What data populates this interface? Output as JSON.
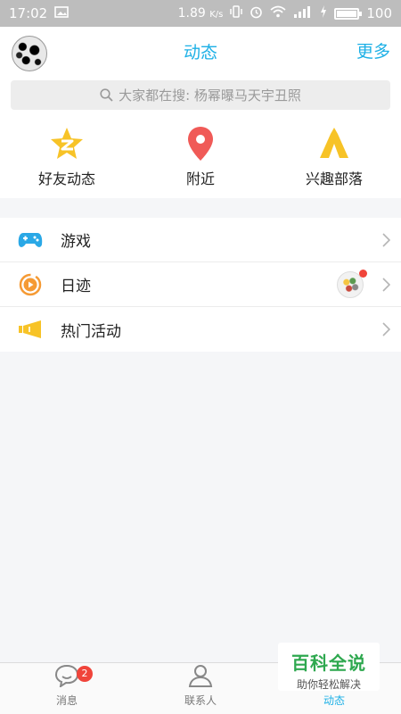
{
  "status_bar": {
    "time": "17:02",
    "speed": "1.89",
    "speed_unit": "K/s",
    "battery": "100"
  },
  "header": {
    "title": "动态",
    "more_label": "更多"
  },
  "search": {
    "placeholder": "大家都在搜: 杨幂曝马天宇丑照"
  },
  "shortcuts": [
    {
      "label": "好友动态",
      "icon": "qzone-star-icon",
      "color": "#f7c327"
    },
    {
      "label": "附近",
      "icon": "location-pin-icon",
      "color": "#f05a57"
    },
    {
      "label": "兴趣部落",
      "icon": "tent-icon",
      "color": "#f7c327"
    }
  ],
  "list": [
    {
      "label": "游戏",
      "icon": "gamepad-icon",
      "color": "#2aa8e6"
    },
    {
      "label": "日迹",
      "icon": "play-circle-icon",
      "color": "#f59a34"
    },
    {
      "label": "热门活动",
      "icon": "megaphone-icon",
      "color": "#f7c327"
    }
  ],
  "tabs": [
    {
      "label": "消息",
      "icon": "chat-bubble-icon",
      "badge": "2"
    },
    {
      "label": "联系人",
      "icon": "contacts-icon"
    },
    {
      "label": "动态",
      "icon": "star-icon",
      "active": true
    }
  ],
  "watermark": {
    "title": "百科全说",
    "subtitle": "助你轻松解决"
  }
}
